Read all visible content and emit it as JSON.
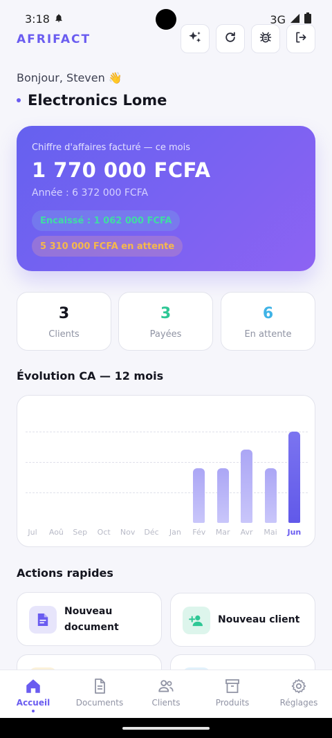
{
  "status": {
    "time": "3:18",
    "network": "3G"
  },
  "header": {
    "brand": "AFRIFACT"
  },
  "greeting": "Bonjour, Steven 👋",
  "company": "Electronics Lome",
  "hero": {
    "subtitle": "Chiffre d'affaires facturé — ce mois",
    "amount": "1 770 000 FCFA",
    "year": "Année : 6 372 000 FCFA",
    "cashed": "Encaissé : 1 062 000 FCFA",
    "pending": "5 310 000 FCFA en attente"
  },
  "stats": [
    {
      "value": "3",
      "label": "Clients",
      "color": "#14151f"
    },
    {
      "value": "3",
      "label": "Payées",
      "color": "#2ec795"
    },
    {
      "value": "6",
      "label": "En attente",
      "color": "#3fb3e6"
    }
  ],
  "chart_section_title": "Évolution CA — 12 mois",
  "chart_data": {
    "type": "bar",
    "categories": [
      "Jul",
      "Aoû",
      "Sep",
      "Oct",
      "Nov",
      "Déc",
      "Jan",
      "Fév",
      "Mar",
      "Avr",
      "Mai",
      "Jun"
    ],
    "values": [
      0,
      0,
      0,
      0,
      0,
      0,
      0,
      0.6,
      0.6,
      0.8,
      0.6,
      1.0
    ],
    "highlighted": "Jun",
    "colors": {
      "bar": "#b8b4f7",
      "active_bar": "#6a62ee"
    },
    "grid": true
  },
  "actions_title": "Actions rapides",
  "actions": [
    {
      "label": "Nouveau document",
      "icon": "document-icon"
    },
    {
      "label": "Nouveau client",
      "icon": "add-person-icon"
    }
  ],
  "nav": [
    {
      "label": "Accueil",
      "icon": "home-icon",
      "active": true
    },
    {
      "label": "Documents",
      "icon": "document-icon",
      "active": false
    },
    {
      "label": "Clients",
      "icon": "people-icon",
      "active": false
    },
    {
      "label": "Produits",
      "icon": "archive-icon",
      "active": false
    },
    {
      "label": "Réglages",
      "icon": "gear-icon",
      "active": false
    }
  ],
  "accent_color": "#6a5cf0"
}
